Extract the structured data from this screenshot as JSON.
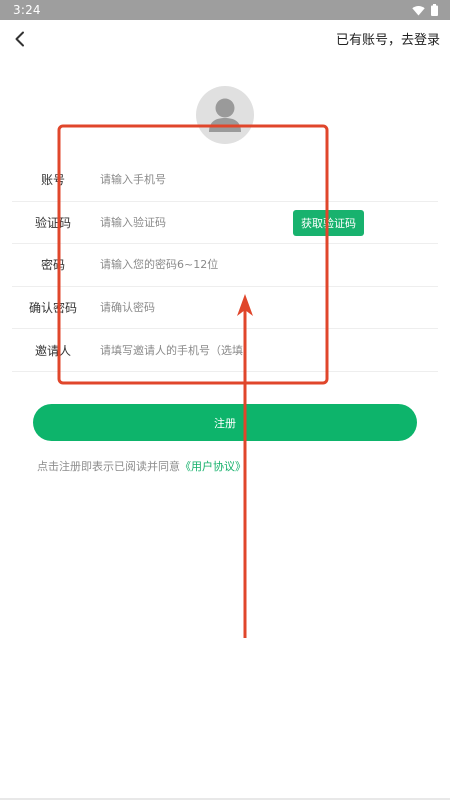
{
  "status_bar": {
    "time": "3:24",
    "icons": [
      "wifi-icon",
      "battery-icon"
    ]
  },
  "header": {
    "back_icon": "chevron-left-icon",
    "login_link": "已有账号，去登录"
  },
  "avatar": {
    "icon": "user-avatar-icon"
  },
  "form": {
    "rows": [
      {
        "label": "账号",
        "placeholder": "请输入手机号"
      },
      {
        "label": "验证码",
        "placeholder": "请输入验证码",
        "action": "获取验证码"
      },
      {
        "label": "密码",
        "placeholder": "请输入您的密码6~12位"
      },
      {
        "label": "确认密码",
        "placeholder": "请确认密码"
      },
      {
        "label": "邀请人",
        "placeholder": "请填写邀请人的手机号（选填）"
      }
    ]
  },
  "register": {
    "label": "注册"
  },
  "agreement": {
    "text": "点击注册即表示已阅读并同意",
    "link": "《用户协议》"
  },
  "colors": {
    "accent": "#0db46b",
    "status_bar": "#9e9e9e",
    "annotation": "#e0462b"
  }
}
